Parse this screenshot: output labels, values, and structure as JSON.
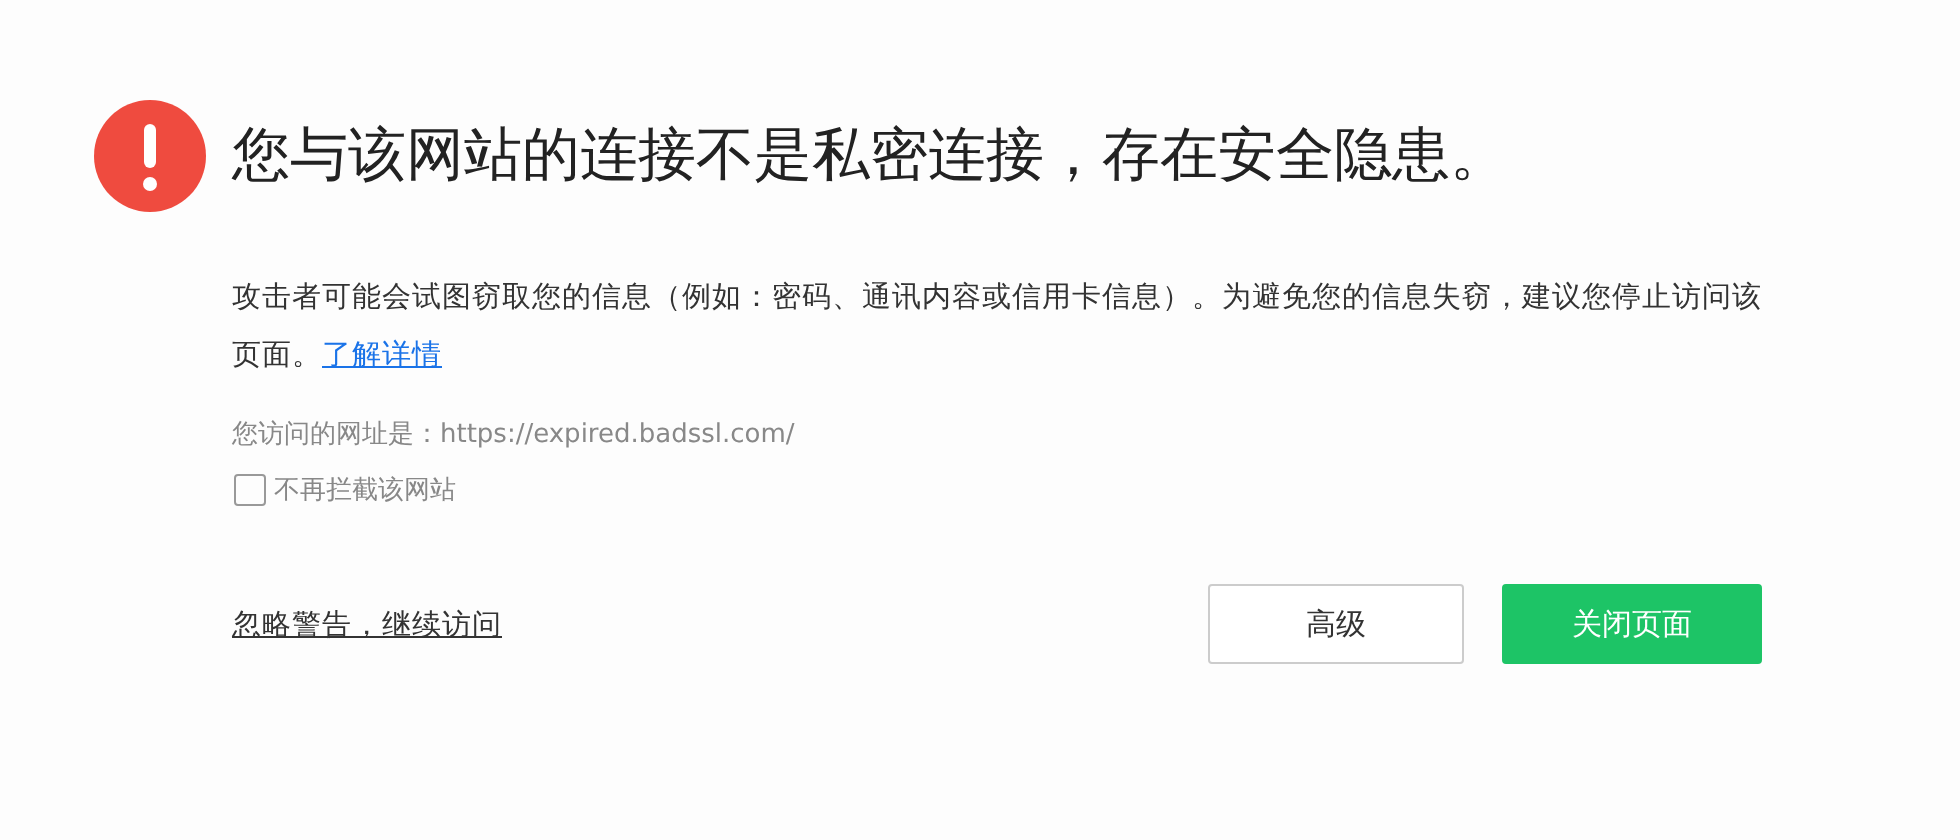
{
  "title": "您与该网站的连接不是私密连接，存在安全隐患。",
  "description": {
    "text": "攻击者可能会试图窃取您的信息（例如：密码、通讯内容或信用卡信息）。为避免您的信息失窃，建议您停止访问该页面。",
    "link": "了解详情"
  },
  "url_line": "您访问的网址是：https://expired.badssl.com/",
  "dont_block": {
    "label": "不再拦截该网站",
    "checked": false
  },
  "ignore_link": "忽略警告，继续访问",
  "buttons": [
    {
      "label": "高级",
      "kind": "secondary"
    },
    {
      "label": "关闭页面",
      "kind": "primary"
    }
  ]
}
